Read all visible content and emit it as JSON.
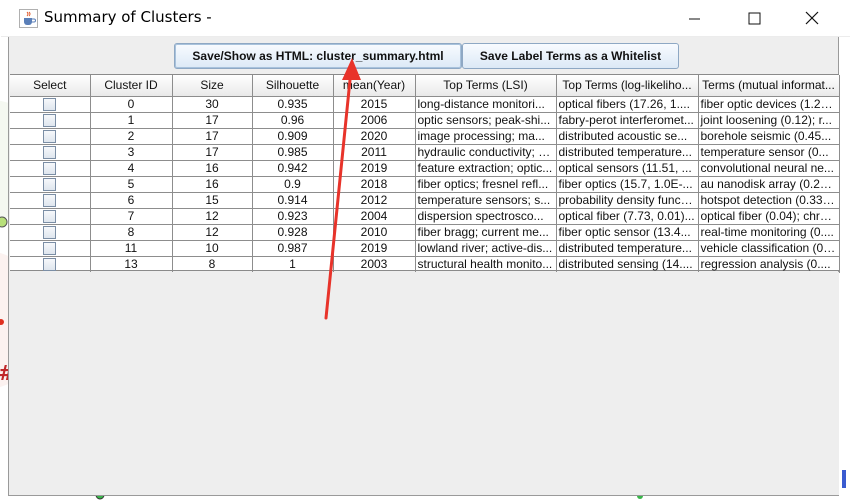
{
  "window": {
    "title": "Summary of Clusters -",
    "app_icon": "java-cup-icon",
    "controls": [
      "minimize-icon",
      "maximize-icon",
      "close-icon"
    ]
  },
  "toolbar": {
    "save_html_label": "Save/Show as HTML: cluster_summary.html",
    "save_whitelist_label": "Save Label Terms as a Whitelist"
  },
  "table": {
    "columns": [
      "Select",
      "Cluster ID",
      "Size",
      "Silhouette",
      "mean(Year)",
      "Top Terms (LSI)",
      "Top Terms (log-likeliho...",
      "Terms (mutual informat..."
    ],
    "rows": [
      {
        "cluster_id": "0",
        "size": "30",
        "silhouette": "0.935",
        "mean_year": "2015",
        "lsi": "long-distance monitori...",
        "llr": "optical fibers (17.26, 1....",
        "mi": "fiber optic devices (1.25..."
      },
      {
        "cluster_id": "1",
        "size": "17",
        "silhouette": "0.96",
        "mean_year": "2006",
        "lsi": "optic sensors; peak-shi...",
        "llr": "fabry-perot interferomet...",
        "mi": "joint loosening (0.12); r..."
      },
      {
        "cluster_id": "2",
        "size": "17",
        "silhouette": "0.909",
        "mean_year": "2020",
        "lsi": "image processing; ma...",
        "llr": "distributed acoustic se...",
        "mi": "borehole seismic (0.45..."
      },
      {
        "cluster_id": "3",
        "size": "17",
        "silhouette": "0.985",
        "mean_year": "2011",
        "lsi": "hydraulic conductivity; fl...",
        "llr": "distributed temperature...",
        "mi": "temperature sensor (0..."
      },
      {
        "cluster_id": "4",
        "size": "16",
        "silhouette": "0.942",
        "mean_year": "2019",
        "lsi": "feature extraction; optic...",
        "llr": "optical sensors (11.51, ...",
        "mi": "convolutional neural ne..."
      },
      {
        "cluster_id": "5",
        "size": "16",
        "silhouette": "0.9",
        "mean_year": "2018",
        "lsi": "fiber optics; fresnel refl...",
        "llr": "fiber optics (15.7, 1.0E-...",
        "mi": "au nanodisk array (0.23..."
      },
      {
        "cluster_id": "6",
        "size": "15",
        "silhouette": "0.914",
        "mean_year": "2012",
        "lsi": "temperature sensors; s...",
        "llr": "probability density functi...",
        "mi": "hotspot detection (0.33)..."
      },
      {
        "cluster_id": "7",
        "size": "12",
        "silhouette": "0.923",
        "mean_year": "2004",
        "lsi": "dispersion spectrosco...",
        "llr": "optical fiber (7.73, 0.01)...",
        "mi": "optical fiber (0.04); chro..."
      },
      {
        "cluster_id": "8",
        "size": "12",
        "silhouette": "0.928",
        "mean_year": "2010",
        "lsi": "fiber bragg; current me...",
        "llr": "fiber optic sensor (13.4...",
        "mi": "real-time monitoring (0...."
      },
      {
        "cluster_id": "11",
        "size": "10",
        "silhouette": "0.987",
        "mean_year": "2019",
        "lsi": "lowland river; active-dis...",
        "llr": "distributed temperature...",
        "mi": "vehicle classification (0...."
      },
      {
        "cluster_id": "13",
        "size": "8",
        "silhouette": "1",
        "mean_year": "2003",
        "lsi": "structural health monito...",
        "llr": "distributed sensing (14....",
        "mi": "regression analysis (0...."
      }
    ]
  },
  "colors": {
    "annotation_arrow": "#e8332a",
    "background_node_green": "#39b54a",
    "background_node_red": "#e03020"
  }
}
